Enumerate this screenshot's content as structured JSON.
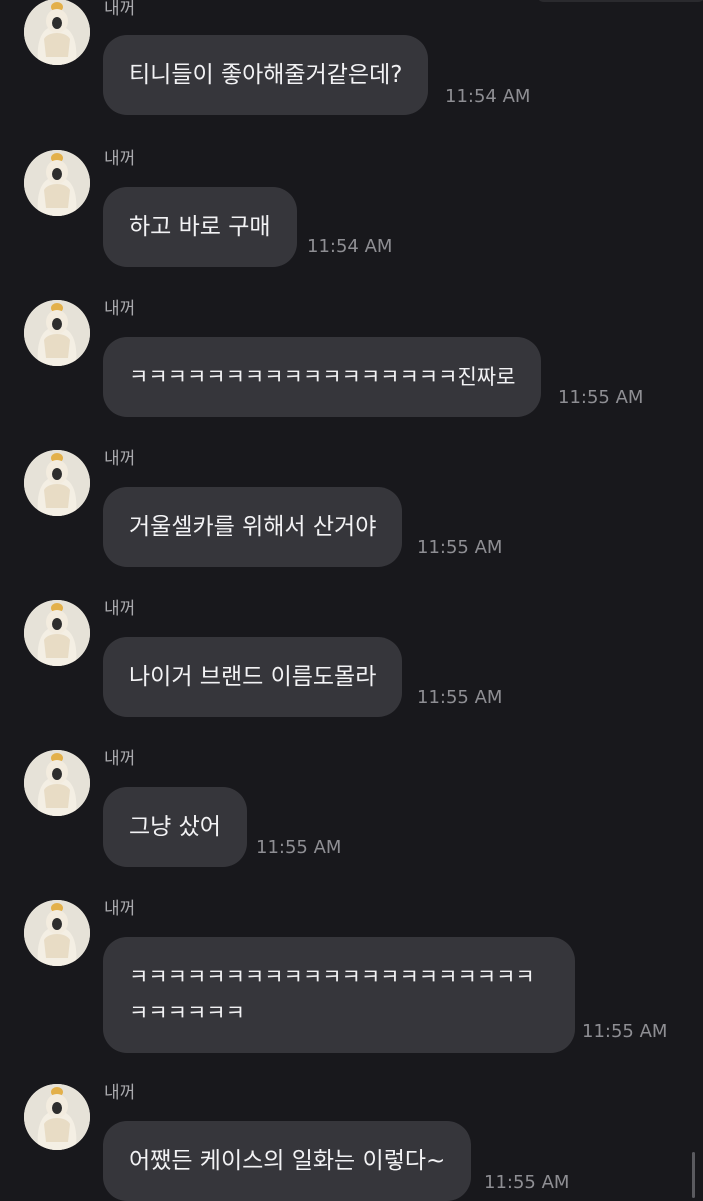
{
  "chat": {
    "messages": [
      {
        "sender": "내꺼",
        "text": "티니들이 좋아해줄거같은데?",
        "time": "11:54 AM"
      },
      {
        "sender": "내꺼",
        "text": "하고 바로 구매",
        "time": "11:54 AM"
      },
      {
        "sender": "내꺼",
        "text": "ㅋㅋㅋㅋㅋㅋㅋㅋㅋㅋㅋㅋㅋㅋㅋㅋㅋ진짜로",
        "time": "11:55 AM"
      },
      {
        "sender": "내꺼",
        "text": "거울셀카를 위해서 산거야",
        "time": "11:55 AM"
      },
      {
        "sender": "내꺼",
        "text": "나이거 브랜드 이름도몰라",
        "time": "11:55 AM"
      },
      {
        "sender": "내꺼",
        "text": "그냥 샀어",
        "time": "11:55 AM"
      },
      {
        "sender": "내꺼",
        "text": "ㅋㅋㅋㅋㅋㅋㅋㅋㅋㅋㅋㅋㅋㅋㅋㅋㅋㅋㅋㅋㅋㅋㅋㅋㅋㅋㅋ",
        "time": "11:55 AM"
      },
      {
        "sender": "내꺼",
        "text": "어쨌든 케이스의 일화는 이렇다~",
        "time": "11:55 AM"
      }
    ]
  },
  "colors": {
    "background": "#18181c",
    "bubble": "#36363b",
    "text": "#f2f2f4",
    "timestamp": "#8e8e93"
  },
  "icons": {
    "avatar": "profile-photo-avatar-icon"
  }
}
